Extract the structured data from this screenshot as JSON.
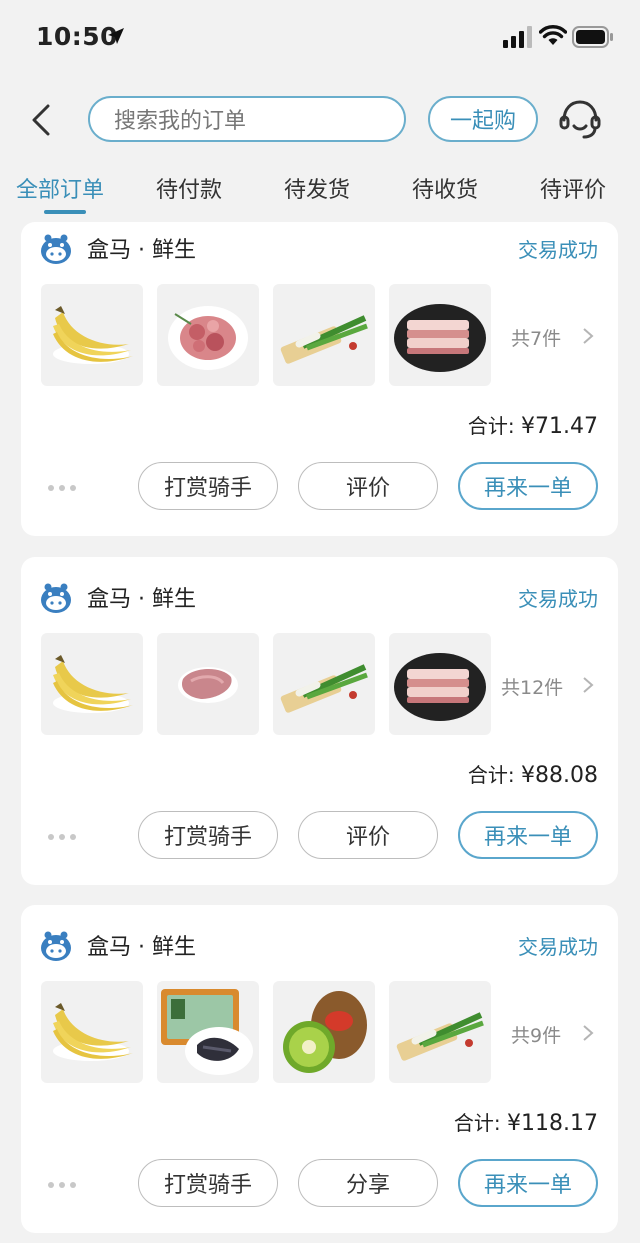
{
  "status_bar": {
    "time": "10:50"
  },
  "header": {
    "search_placeholder": "搜索我的订单",
    "group_buy_label": "一起购",
    "icons": [
      "back-icon",
      "customer-service-icon"
    ]
  },
  "tabs": [
    {
      "label": "全部订单",
      "active": true
    },
    {
      "label": "待付款",
      "active": false
    },
    {
      "label": "待发货",
      "active": false
    },
    {
      "label": "待收货",
      "active": false
    },
    {
      "label": "待评价",
      "active": false
    }
  ],
  "colors": {
    "accent": "#3a8fb8",
    "background": "#f2f2f2",
    "card": "#ffffff"
  },
  "orders": [
    {
      "store": "盒马 · 鲜生",
      "status": "交易成功",
      "items": [
        "banana",
        "pork-chunks",
        "green-onion",
        "pork-belly"
      ],
      "count": "共7件",
      "total_label": "合计:",
      "total": "¥71.47",
      "buttons": [
        "打赏骑手",
        "评价",
        "再来一单"
      ]
    },
    {
      "store": "盒马 · 鲜生",
      "status": "交易成功",
      "items": [
        "banana",
        "beef-slice",
        "green-onion",
        "pork-belly"
      ],
      "count": "共12件",
      "total_label": "合计:",
      "total": "¥88.08",
      "buttons": [
        "打赏骑手",
        "评价",
        "再来一单"
      ]
    },
    {
      "store": "盒马 · 鲜生",
      "status": "交易成功",
      "items": [
        "banana",
        "packaged-chicken-feet",
        "kiwi",
        "green-onion"
      ],
      "count": "共9件",
      "total_label": "合计:",
      "total": "¥118.17",
      "buttons": [
        "打赏骑手",
        "分享",
        "再来一单"
      ]
    }
  ]
}
